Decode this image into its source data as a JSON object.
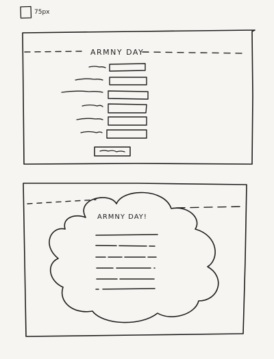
{
  "legend": {
    "size_label": "75px"
  },
  "frame_1": {
    "title": "ARMNY DAY",
    "form_rows": 6,
    "submit_button_label": "",
    "colors": {
      "ink": "#1e1e1e",
      "paper": "#f6f5f2"
    }
  },
  "frame_2": {
    "title": "ARMNY DAY!",
    "text_lines": 6,
    "container_shape": "cloud"
  }
}
